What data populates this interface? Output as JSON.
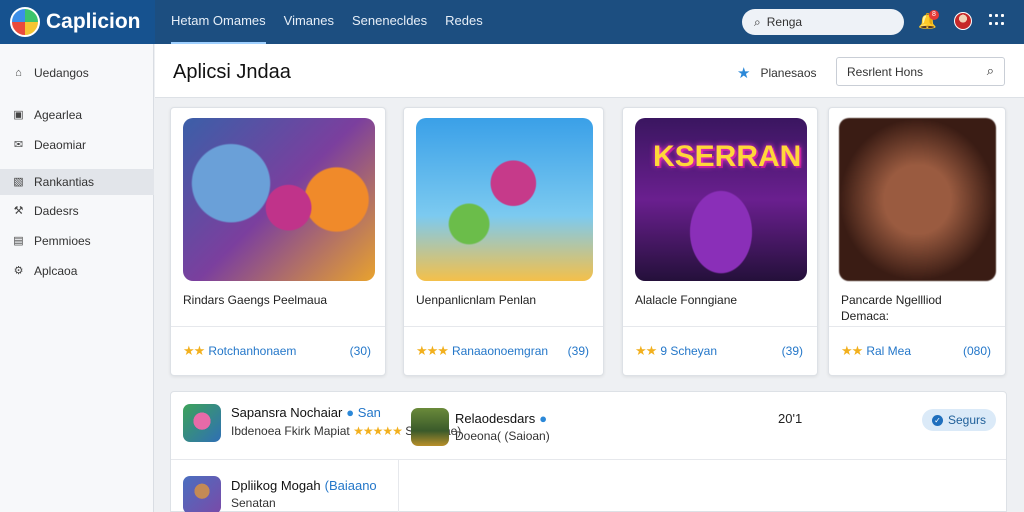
{
  "brand": {
    "name": "Caplicion"
  },
  "top_nav": [
    "Hetam Omames",
    "Vimanes",
    "Senenecldes",
    "Redes"
  ],
  "top_search": {
    "placeholder": "Renga"
  },
  "notifications": {
    "badge": "8"
  },
  "sidebar": {
    "items": [
      {
        "label": "Uedangos",
        "icon": "home-icon"
      },
      {
        "label": "Agearlea",
        "icon": "box-icon"
      },
      {
        "label": "Deaomiar",
        "icon": "mail-icon"
      },
      {
        "label": "Rankantias",
        "icon": "chart-icon"
      },
      {
        "label": "Dadesrs",
        "icon": "tools-icon"
      },
      {
        "label": "Pemmioes",
        "icon": "doc-icon"
      },
      {
        "label": "Aplcaoa",
        "icon": "settings-icon"
      }
    ],
    "active_index": 3
  },
  "header": {
    "title": "Aplicsi Jndaa",
    "favorites_label": "Planesaos",
    "search_placeholder": "Resrlent Hons"
  },
  "cards": [
    {
      "title": "Rindars Gaengs Peelmaua",
      "developer": "Rotchanhonaem",
      "count": "(30)",
      "rating": 2
    },
    {
      "title": "Uenpanlicnlam Penlan",
      "developer": "Ranaaonoemgran",
      "count": "(39)",
      "rating": 3
    },
    {
      "title": "Alalacle Fonngiane",
      "developer": "9 Scheyan",
      "count": "(39)",
      "rating": 2,
      "art_text": "KSERRAN"
    },
    {
      "title": "Pancarde Ngellliod Demaca:",
      "developer": "Ral Mea",
      "count": "(080)",
      "rating": 2
    }
  ],
  "list": {
    "row1": {
      "title": "Sapansra Nochaiar",
      "verified_link": "San",
      "sub_start": "Ibdenoea Fkirk",
      "sub_mid": "Mapiat",
      "sub_end": "Seeoerae)"
    },
    "row2a": {
      "title": "Dpliikog Mogah",
      "link": "(Baiaano",
      "sub": "Senatan"
    },
    "row2b": {
      "title": "Relaodesdars",
      "sub": "Doeona( (Saioan)",
      "count": "20'1"
    },
    "security_label": "Segurs"
  },
  "colors": {
    "topbar": "#1c4e80",
    "accent": "#2477c9",
    "stars": "#f2b01e"
  }
}
